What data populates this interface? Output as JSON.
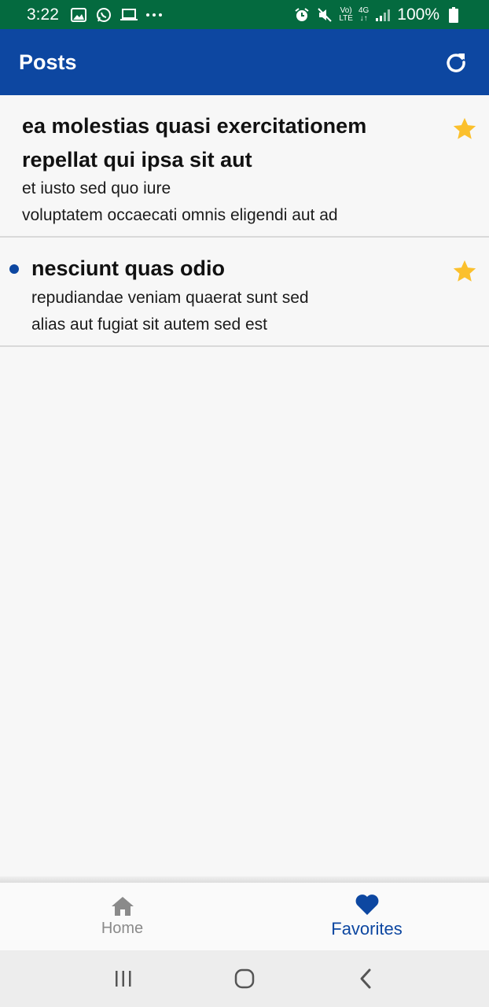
{
  "status_bar": {
    "time": "3:22",
    "volte_top": "Vo)",
    "volte_bottom": "LTE",
    "network": "4G",
    "battery": "100%",
    "icons": [
      "gallery-icon",
      "whatsapp-icon",
      "laptop-icon",
      "more-dots-icon",
      "alarm-icon",
      "mute-icon",
      "signal-icon",
      "battery-icon"
    ]
  },
  "app_bar": {
    "title": "Posts",
    "refresh_icon": "refresh-icon"
  },
  "posts": [
    {
      "title_line1": "ea molestias quasi exercitationem",
      "title_line2": "repellat qui ipsa sit aut",
      "body_line1": "et iusto sed quo iure",
      "body_line2": "voluptatem occaecati omnis eligendi aut ad",
      "favorite": true,
      "unread": false
    },
    {
      "title_line1": "nesciunt quas odio",
      "body_line1": "repudiandae veniam quaerat sunt sed",
      "body_line2": "alias aut fugiat sit autem sed est",
      "favorite": true,
      "unread": true
    }
  ],
  "bottom_nav": {
    "home_label": "Home",
    "favorites_label": "Favorites",
    "active": "Favorites"
  },
  "colors": {
    "status_bar": "#046a3f",
    "primary": "#0d47a1",
    "star": "#fbc02d",
    "inactive": "#8a8a8a"
  }
}
